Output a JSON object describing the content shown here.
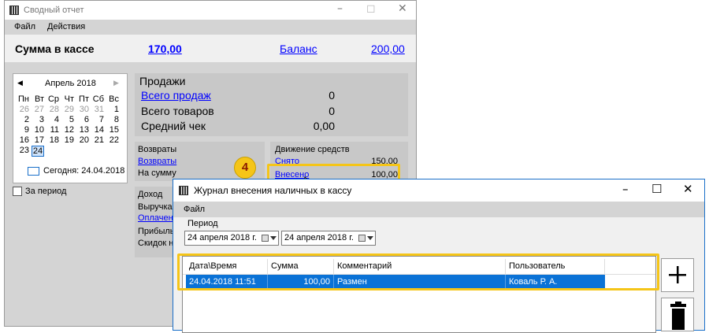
{
  "main_window": {
    "title": "Сводный отчет",
    "menu": [
      "Файл",
      "Действия"
    ],
    "summary": {
      "cash_label": "Сумма в кассе",
      "cash_value": "170,00",
      "balance_label": "Баланс",
      "balance_value": "200,00"
    },
    "calendar": {
      "month_title": "Апрель 2018",
      "weekdays": [
        "Пн",
        "Вт",
        "Ср",
        "Чт",
        "Пт",
        "Сб",
        "Вс"
      ],
      "rows": [
        [
          "26",
          "27",
          "28",
          "29",
          "30",
          "31",
          "1"
        ],
        [
          "2",
          "3",
          "4",
          "5",
          "6",
          "7",
          "8"
        ],
        [
          "9",
          "10",
          "11",
          "12",
          "13",
          "14",
          "15"
        ],
        [
          "16",
          "17",
          "18",
          "19",
          "20",
          "21",
          "22"
        ],
        [
          "23",
          "24",
          "",
          "",
          "",
          "",
          ""
        ]
      ],
      "selected_day": "24",
      "today_label": "Сегодня: 24.04.2018"
    },
    "period_checkbox_label": "За период",
    "sales": {
      "title": "Продажи",
      "rows": [
        {
          "label": "Всего продаж",
          "value": "0"
        },
        {
          "label": "Всего товаров",
          "value": "0"
        },
        {
          "label": "Средний чек",
          "value": "0,00"
        }
      ]
    },
    "returns": {
      "title": "Возвраты",
      "link": "Возвраты",
      "sum_label": "На сумму"
    },
    "cash_flow": {
      "title": "Движение средств",
      "rows": [
        {
          "label": "Снято",
          "value": "150,00"
        },
        {
          "label": "Внесено",
          "value": "100,00"
        }
      ]
    },
    "income": {
      "title": "Доход",
      "rows": [
        "Выручка",
        "Оплачено",
        "Прибыль",
        "Скидок на"
      ]
    }
  },
  "step_badge": "4",
  "journal_window": {
    "title": "Журнал внесения наличных в кассу",
    "menu": [
      "Файл"
    ],
    "period_label": "Период",
    "date_from": "24  апреля  2018 г.",
    "date_to": "24  апреля  2018 г.",
    "columns": [
      "Дата\\Время",
      "Сумма",
      "Комментарий",
      "Пользователь"
    ],
    "rows": [
      {
        "datetime": "24.04.2018 11:51",
        "amount": "100,00",
        "comment": "Размен",
        "user": "Коваль Р. А."
      }
    ]
  },
  "colors": {
    "highlight": "#f5c518",
    "selection": "#0a72d6",
    "link": "#0000ff"
  }
}
